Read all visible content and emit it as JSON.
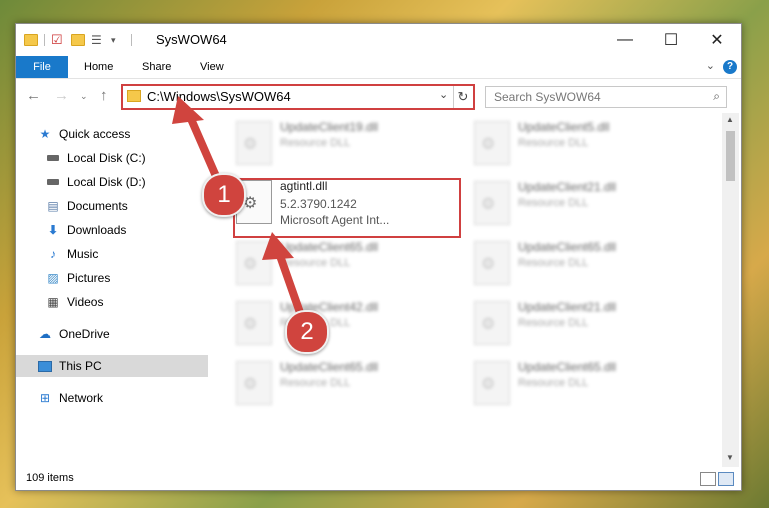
{
  "window": {
    "title": "SysWOW64",
    "minimize": "—",
    "maximize": "☐",
    "close": "✕"
  },
  "ribbon": {
    "tabs": [
      "File",
      "Home",
      "Share",
      "View"
    ],
    "help": "?"
  },
  "navigation": {
    "address_path": "C:\\Windows\\SysWOW64",
    "search_placeholder": "Search SysWOW64"
  },
  "sidebar": {
    "items": [
      {
        "label": "Quick access",
        "icon": "star-icon",
        "pinned": false
      },
      {
        "label": "Local Disk (C:)",
        "icon": "drive-icon",
        "pinned": true
      },
      {
        "label": "Local Disk (D:)",
        "icon": "drive-icon",
        "pinned": true
      },
      {
        "label": "Documents",
        "icon": "documents-icon",
        "pinned": true
      },
      {
        "label": "Downloads",
        "icon": "download-icon",
        "pinned": true
      },
      {
        "label": "Music",
        "icon": "music-icon",
        "pinned": true
      },
      {
        "label": "Pictures",
        "icon": "pictures-icon",
        "pinned": true
      },
      {
        "label": "Videos",
        "icon": "videos-icon",
        "pinned": true
      },
      {
        "label": "OneDrive",
        "icon": "cloud-icon",
        "pinned": false
      },
      {
        "label": "This PC",
        "icon": "computer-icon",
        "pinned": false,
        "selected": true
      },
      {
        "label": "Network",
        "icon": "network-icon",
        "pinned": false
      }
    ]
  },
  "files": {
    "focused": {
      "name": "agtintl.dll",
      "version": "5.2.3790.1242",
      "company": "Microsoft Agent Int..."
    },
    "left_column": [
      {
        "name": "UpdateClient19.dll",
        "desc": "Resource DLL"
      },
      {
        "name": "UpdateClient65.dll",
        "desc": "Resource DLL"
      },
      {
        "name": "UpdateClient42.dll",
        "desc": "Resource DLL"
      },
      {
        "name": "UpdateClient65.dll",
        "desc": "Resource DLL"
      }
    ],
    "right_column": [
      {
        "name": "UpdateClient5.dll",
        "desc": "Resource DLL"
      },
      {
        "name": "UpdateClient21.dll",
        "desc": "Resource DLL"
      },
      {
        "name": "UpdateClient65.dll",
        "desc": "Resource DLL"
      },
      {
        "name": "UpdateClient21.dll",
        "desc": "Resource DLL"
      },
      {
        "name": "UpdateClient65.dll",
        "desc": "Resource DLL"
      }
    ]
  },
  "status": {
    "item_count": "109 items"
  },
  "annotations": {
    "step1": "1",
    "step2": "2"
  },
  "colors": {
    "accent": "#1979ca",
    "highlight": "#d04040"
  }
}
